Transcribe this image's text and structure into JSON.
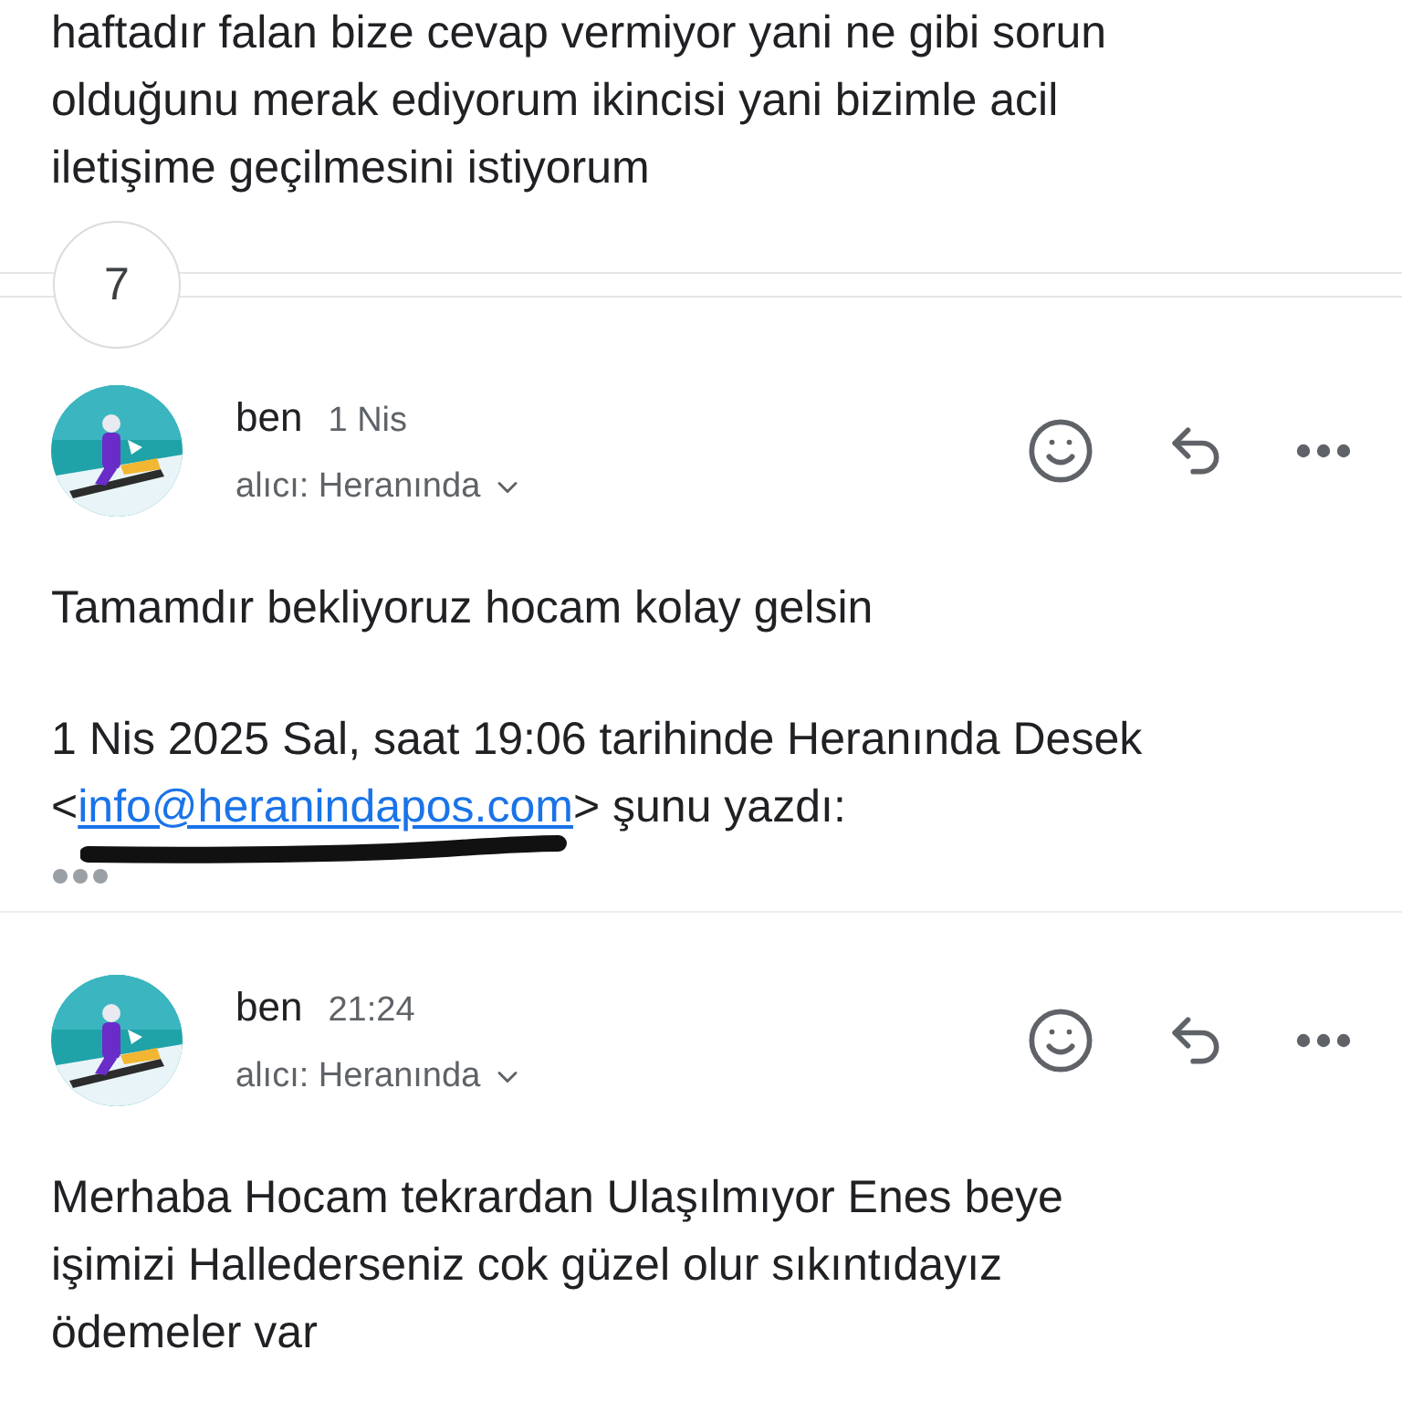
{
  "previous_message": {
    "lines": [
      "haftadır falan bize cevap vermiyor yani ne gibi sorun",
      "olduğunu merak ediyorum ikincisi yani bizimle acil",
      "iletişime geçilmesini istiyorum"
    ]
  },
  "collapsed_count": "7",
  "messages": [
    {
      "sender": "ben",
      "time": "1 Nis",
      "recipient": "alıcı: Heranında",
      "body": [
        "Tamamdır bekliyoruz hocam kolay gelsin"
      ],
      "quote": {
        "header": "1 Nis 2025 Sal, saat 19:06 tarihinde Heranında Desek",
        "open": "<",
        "email": "info@heranindapos.com",
        "close": "> şunu yazdı:",
        "redacted": true
      },
      "trimmed": true
    },
    {
      "sender": "ben",
      "time": "21:24",
      "recipient": "alıcı: Heranında",
      "body": [
        "Merhaba Hocam tekrardan Ulaşılmıyor Enes beye",
        "işimizi Hallederseniz cok güzel olur sıkıntıdayız",
        "ödemeler var"
      ]
    }
  ]
}
